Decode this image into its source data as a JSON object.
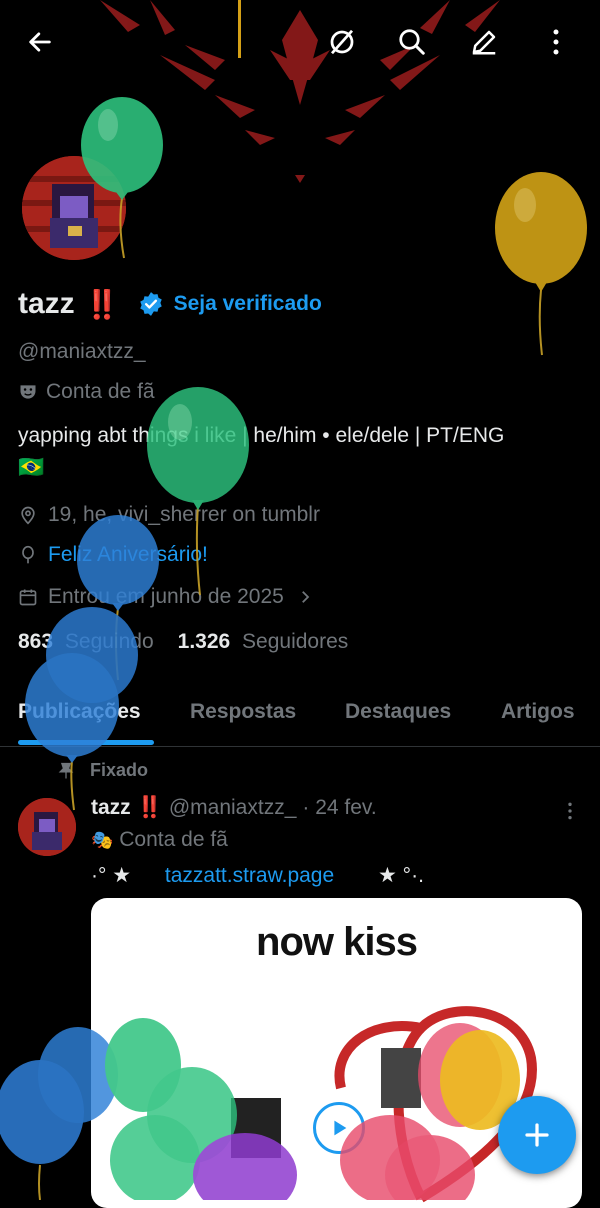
{
  "profile": {
    "name": "tazz",
    "name_emoji": "‼️",
    "verify_label": "Seja verificado",
    "handle": "@maniaxtzz_",
    "fan_label": "Conta de fã",
    "bio": "yapping abt things i like | he/him • ele/dele | PT/ENG",
    "flag": "🇧🇷",
    "location": "19, he, vivi_sherrer on tumblr",
    "birthday": "Feliz Aniversário!",
    "joined": "Entrou em junho de 2025",
    "following_count": "863",
    "following_label": "Seguindo",
    "followers_count": "1.326",
    "followers_label": "Seguidores"
  },
  "tabs": [
    {
      "label": "Publicações"
    },
    {
      "label": "Respostas"
    },
    {
      "label": "Destaques"
    },
    {
      "label": "Artigos"
    }
  ],
  "post": {
    "pinned_label": "Fixado",
    "author": "tazz",
    "author_emoji": "‼️",
    "handle": "@maniaxtzz_",
    "date": "· 24 fev.",
    "fan_label": "Conta de fã",
    "link_prefix": "·° ★",
    "link": "tazzatt.straw.page",
    "link_suffix": "★ °·.",
    "media_title": "now kiss"
  },
  "colors": {
    "accent": "#1d9bf0",
    "background": "#000000",
    "text": "#e7e9ea",
    "muted": "#71767b"
  },
  "icons": {
    "back": "arrow-left-icon",
    "hide": "eye-slash-icon",
    "search": "search-icon",
    "edit": "pencil-icon",
    "more": "more-vertical-icon",
    "compose": "plus-icon"
  }
}
